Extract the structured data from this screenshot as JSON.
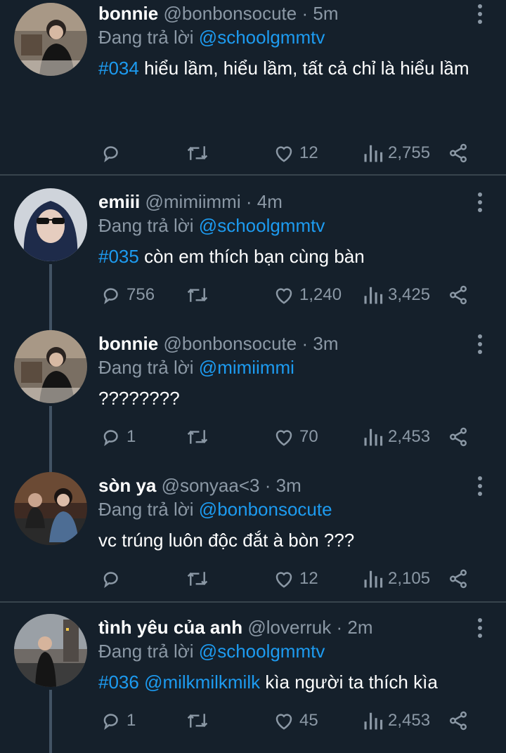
{
  "reply_prefix": "Đang trả lời",
  "icons": [
    "reply-icon",
    "retweet-icon",
    "like-icon",
    "views-icon",
    "share-icon",
    "more-icon"
  ],
  "colors": {
    "background": "#15202b",
    "secondary": "#8b98a5",
    "accent": "#1d9bf0",
    "divider": "#38444d"
  },
  "tweets": [
    {
      "name": "bonnie",
      "handle": "@bonbonsocute",
      "sep": "·",
      "time": "5m",
      "reply_to": "@schoolgmmtv",
      "tag": "#034",
      "mention": "",
      "text": " hiểu lầm, hiểu lầm, tất cả chỉ là hiểu lầm",
      "replies": "",
      "retweets": "",
      "likes": "12",
      "views": "2,755"
    },
    {
      "name": "emiii",
      "handle": "@mimiimmi",
      "sep": "·",
      "time": "4m",
      "reply_to": "@schoolgmmtv",
      "tag": "#035",
      "mention": "",
      "text": " còn em thích bạn cùng bàn",
      "replies": "756",
      "retweets": "",
      "likes": "1,240",
      "views": "3,425"
    },
    {
      "name": "bonnie",
      "handle": "@bonbonsocute",
      "sep": "·",
      "time": "3m",
      "reply_to": "@mimiimmi",
      "tag": "",
      "mention": "",
      "text": "????????",
      "replies": "1",
      "retweets": "",
      "likes": "70",
      "views": "2,453"
    },
    {
      "name": "sòn ya",
      "handle": "@sonyaa<3",
      "sep": "·",
      "time": "3m",
      "reply_to": "@bonbonsocute",
      "tag": "",
      "mention": "",
      "text": "vc trúng luôn độc đắt à bòn ???",
      "replies": "",
      "retweets": "",
      "likes": "12",
      "views": "2,105"
    },
    {
      "name": "tình yêu của anh",
      "handle": "@loverruk",
      "sep": "·",
      "time": "2m",
      "reply_to": "@schoolgmmtv",
      "tag": "#036",
      "mention": "@milkmilkmilk",
      "text": " kìa người ta thích kìa",
      "replies": "1",
      "retweets": "",
      "likes": "45",
      "views": "2,453"
    }
  ]
}
